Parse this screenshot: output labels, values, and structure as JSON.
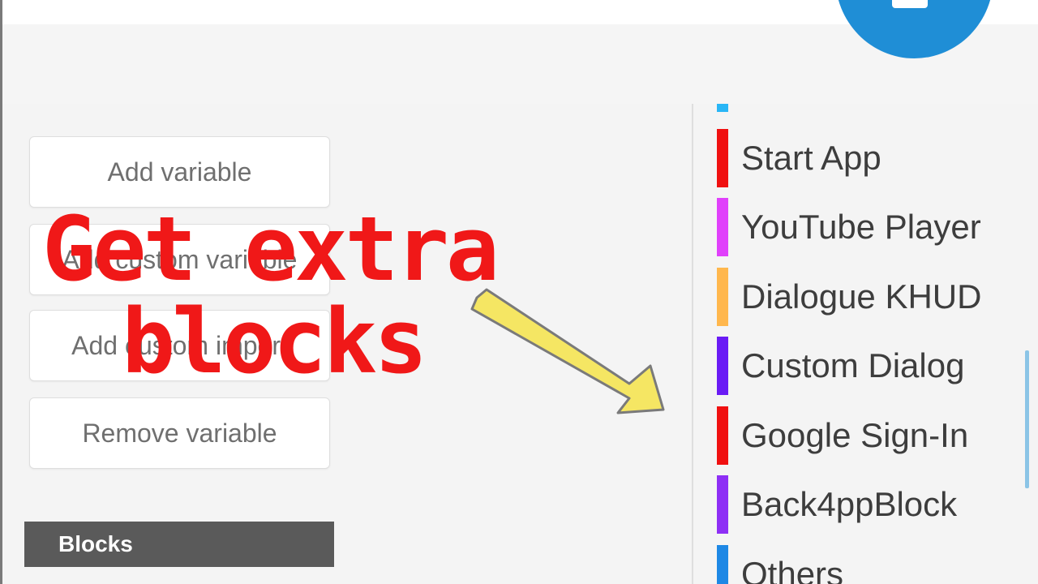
{
  "left_panel": {
    "buttons": [
      {
        "label": "Add variable"
      },
      {
        "label": "Add custom variable"
      },
      {
        "label": "Add custom import"
      },
      {
        "label": "Remove variable"
      }
    ],
    "section_header": "Blocks"
  },
  "categories": [
    {
      "label": "",
      "color": "#29b6f6"
    },
    {
      "label": "Start App",
      "color": "#f01010"
    },
    {
      "label": "YouTube  Player",
      "color": "#e040fb"
    },
    {
      "label": "Dialogue KHUD",
      "color": "#ffb74d"
    },
    {
      "label": "Custom Dialog",
      "color": "#6a1bf5"
    },
    {
      "label": "Google Sign-In",
      "color": "#f01010"
    },
    {
      "label": "Back4ppBlock",
      "color": "#8e2ff5"
    },
    {
      "label": "Others",
      "color": "#1e88e5"
    }
  ],
  "overlay": {
    "line1": "Get extra",
    "line2": "blocks"
  },
  "colors": {
    "fab": "#1f8ed6",
    "arrow_fill": "#f5e663",
    "overlay_text": "#f01818"
  }
}
